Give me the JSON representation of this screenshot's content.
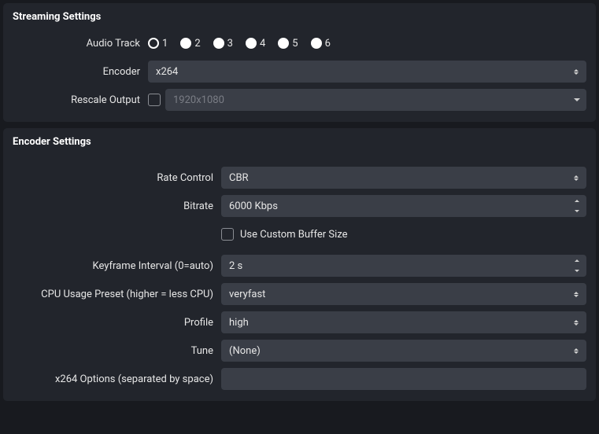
{
  "streaming": {
    "title": "Streaming Settings",
    "audio_track_label": "Audio Track",
    "audio_track_options": [
      "1",
      "2",
      "3",
      "4",
      "5",
      "6"
    ],
    "audio_track_selected": 0,
    "encoder_label": "Encoder",
    "encoder_value": "x264",
    "rescale_label": "Rescale Output",
    "rescale_checked": false,
    "rescale_value": "1920x1080"
  },
  "encoder": {
    "title": "Encoder Settings",
    "rate_control_label": "Rate Control",
    "rate_control_value": "CBR",
    "bitrate_label": "Bitrate",
    "bitrate_value": "6000 Kbps",
    "custom_buffer_label": "Use Custom Buffer Size",
    "custom_buffer_checked": false,
    "keyframe_label": "Keyframe Interval (0=auto)",
    "keyframe_value": "2 s",
    "cpu_preset_label": "CPU Usage Preset (higher = less CPU)",
    "cpu_preset_value": "veryfast",
    "profile_label": "Profile",
    "profile_value": "high",
    "tune_label": "Tune",
    "tune_value": "(None)",
    "x264_options_label": "x264 Options (separated by space)",
    "x264_options_value": ""
  }
}
